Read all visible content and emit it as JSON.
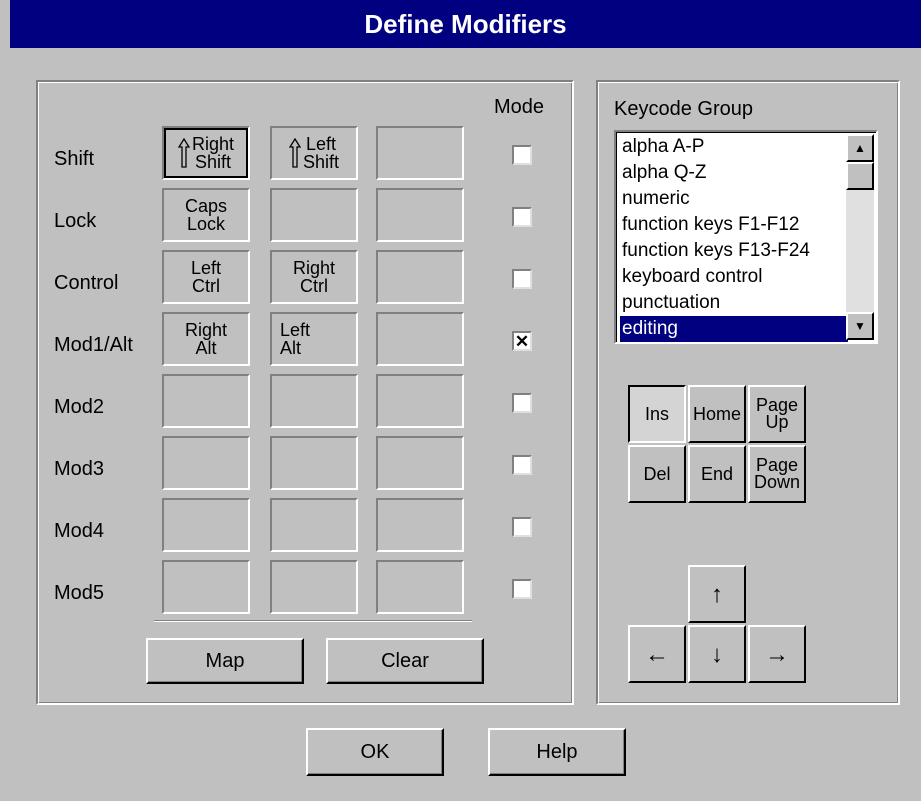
{
  "window": {
    "title": "Define Modifiers"
  },
  "modifiers": {
    "mode_header": "Mode",
    "rows": [
      {
        "name": "Shift",
        "keys": [
          "Right\nShift",
          "Left\nShift",
          ""
        ],
        "mode_checked": false
      },
      {
        "name": "Lock",
        "keys": [
          "Caps\nLock",
          "",
          ""
        ],
        "mode_checked": false
      },
      {
        "name": "Control",
        "keys": [
          "Left\nCtrl",
          "Right\nCtrl",
          ""
        ],
        "mode_checked": false
      },
      {
        "name": "Mod1/Alt",
        "keys": [
          "Right\nAlt",
          "Left\nAlt",
          ""
        ],
        "mode_checked": true
      },
      {
        "name": "Mod2",
        "keys": [
          "",
          "",
          ""
        ],
        "mode_checked": false
      },
      {
        "name": "Mod3",
        "keys": [
          "",
          "",
          ""
        ],
        "mode_checked": false
      },
      {
        "name": "Mod4",
        "keys": [
          "",
          "",
          ""
        ],
        "mode_checked": false
      },
      {
        "name": "Mod5",
        "keys": [
          "",
          "",
          ""
        ],
        "mode_checked": false
      }
    ],
    "check_mark": "✕",
    "map_label": "Map",
    "clear_label": "Clear"
  },
  "keycode_group": {
    "label": "Keycode Group",
    "items": [
      "alpha A-P",
      "alpha Q-Z",
      "numeric",
      "function keys F1-F12",
      "function keys F13-F24",
      "keyboard control",
      "punctuation",
      "editing"
    ],
    "selected": "editing",
    "scroll_up_glyph": "▲",
    "scroll_down_glyph": "▼"
  },
  "editing_keys": [
    {
      "label": "Ins",
      "pressed": true
    },
    {
      "label": "Home",
      "pressed": false
    },
    {
      "label": "Page\nUp",
      "pressed": false
    },
    {
      "label": "Del",
      "pressed": false
    },
    {
      "label": "End",
      "pressed": false
    },
    {
      "label": "Page\nDown",
      "pressed": false
    }
  ],
  "arrow_keys": {
    "up": "↑",
    "left": "←",
    "down": "↓",
    "right": "→"
  },
  "footer": {
    "ok_label": "OK",
    "help_label": "Help"
  },
  "colors": {
    "titlebar": "#000080",
    "face": "#c0c0c0",
    "selection": "#000080"
  }
}
